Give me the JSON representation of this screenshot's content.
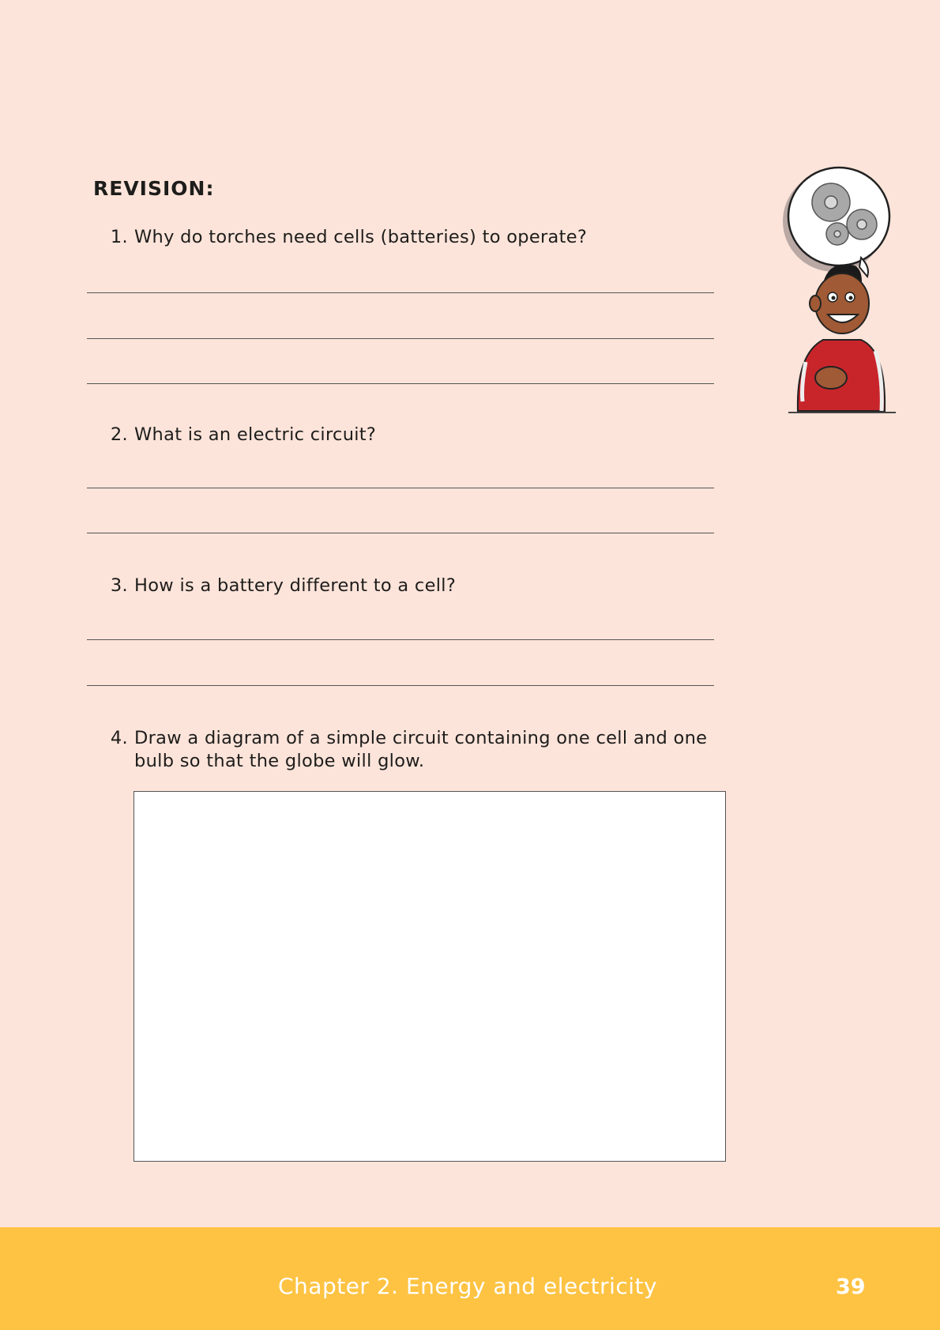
{
  "heading": "REVISION:",
  "questions": [
    {
      "number": "1.",
      "text": "Why do torches need cells (batteries) to operate?"
    },
    {
      "number": "2.",
      "text": "What is an electric circuit?"
    },
    {
      "number": "3.",
      "text": "How is a battery different to a cell?"
    },
    {
      "number": "4.",
      "text": "Draw a diagram of a simple circuit containing one cell and one",
      "text2": "bulb so that the globe will glow."
    }
  ],
  "footer": {
    "chapter": "Chapter 2.   Energy and electricity",
    "page_number": "39"
  },
  "colors": {
    "background": "#fde4da",
    "footer": "#fec343",
    "text": "#1d1d1b"
  },
  "icons": [
    "thinking-boy-mascot-icon",
    "gears-icon"
  ]
}
